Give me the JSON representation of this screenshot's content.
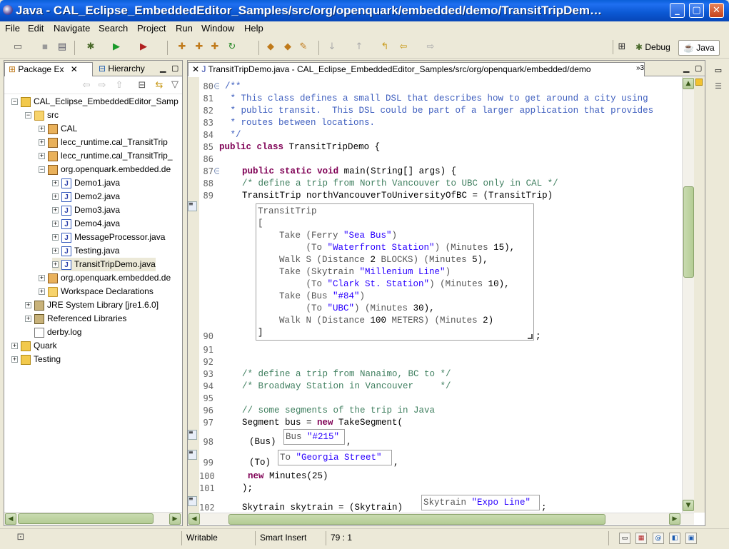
{
  "window": {
    "title": "Java - CAL_Eclipse_EmbeddedEditor_Samples/src/org/openquark/embedded/demo/TransitTripDem…",
    "min": "_",
    "max": "▢",
    "close": "✕"
  },
  "menu": [
    "File",
    "Edit",
    "Navigate",
    "Search",
    "Project",
    "Run",
    "Window",
    "Help"
  ],
  "perspectives": {
    "debug": "Debug",
    "java": "Java"
  },
  "package_explorer": {
    "tabs": [
      {
        "label": "Package Ex"
      },
      {
        "label": "Hierarchy"
      }
    ],
    "tree": [
      {
        "label": "CAL_Eclipse_EmbeddedEditor_Samp",
        "icon": "project-icon",
        "twisty": "−"
      },
      {
        "label": "src",
        "icon": "source-folder-icon",
        "twisty": "−"
      },
      {
        "label": "CAL",
        "icon": "package-icon",
        "twisty": "+"
      },
      {
        "label": "lecc_runtime.cal_TransitTrip",
        "icon": "package-icon",
        "twisty": "+"
      },
      {
        "label": "lecc_runtime.cal_TransitTrip_",
        "icon": "package-icon",
        "twisty": "+"
      },
      {
        "label": "org.openquark.embedded.de",
        "icon": "package-icon",
        "twisty": "−"
      },
      {
        "label": "Demo1.java",
        "icon": "java-file-icon",
        "twisty": "+"
      },
      {
        "label": "Demo2.java",
        "icon": "java-file-icon",
        "twisty": "+"
      },
      {
        "label": "Demo3.java",
        "icon": "java-file-icon",
        "twisty": "+"
      },
      {
        "label": "Demo4.java",
        "icon": "java-file-icon",
        "twisty": "+"
      },
      {
        "label": "MessageProcessor.java",
        "icon": "java-file-icon",
        "twisty": "+"
      },
      {
        "label": "Testing.java",
        "icon": "java-file-icon",
        "twisty": "+"
      },
      {
        "label": "TransitTripDemo.java",
        "icon": "java-file-icon",
        "twisty": "+"
      },
      {
        "label": "org.openquark.embedded.de",
        "icon": "package-icon",
        "twisty": "+"
      },
      {
        "label": "Workspace Declarations",
        "icon": "folder-icon",
        "twisty": "+"
      },
      {
        "label": "JRE System Library [jre1.6.0]",
        "icon": "library-icon",
        "twisty": "+"
      },
      {
        "label": "Referenced Libraries",
        "icon": "library-icon",
        "twisty": "+"
      },
      {
        "label": "derby.log",
        "icon": "file-icon",
        "twisty": ""
      },
      {
        "label": "Quark",
        "icon": "project-icon",
        "twisty": "+"
      },
      {
        "label": "Testing",
        "icon": "project-icon",
        "twisty": "+"
      }
    ]
  },
  "editor": {
    "tab_label": "TransitTripDemo.java - CAL_Eclipse_EmbeddedEditor_Samples/src/org/openquark/embedded/demo",
    "overflow_count": "»3",
    "line_numbers": [
      "80",
      "81",
      "82",
      "83",
      "84",
      "85",
      "86",
      "87",
      "88",
      "89",
      "90",
      "91",
      "92",
      "93",
      "94",
      "95",
      "96",
      "97",
      "98",
      "99",
      "100",
      "101",
      "102"
    ],
    "line_80": "/**",
    "line_81": " * This class defines a small DSL that describes how to get around a city using",
    "line_82": " * public transit.  This DSL could be part of a larger application that provides",
    "line_83": " * routes between locations.",
    "line_84": " */",
    "kw_public": "public",
    "kw_class": "class",
    "kw_static": "static",
    "kw_void": "void",
    "kw_new": "new",
    "class_decl": " TransitTripDemo {",
    "main_sig": " main(String[] args) {",
    "comment_88": "/* define a trip from North Vancouver to UBC only in CAL */",
    "line_89": "TransitTrip northVancouverToUniversityOfBC = (TransitTrip)",
    "line_90_tail": ";",
    "embedded_trip": {
      "header": "TransitTrip",
      "open": "[",
      "close": "]",
      "t1a": "    Take (Ferry ",
      "t1s": "\"Sea Bus\"",
      "t1b": ")",
      "t2a": "         (To ",
      "t2s": "\"Waterfront Station\"",
      "t2b": ") (Minutes ",
      "t2n": "15",
      "t2c": "),",
      "t3a": "    Walk S (Distance ",
      "t3n": "2",
      "t3b": " BLOCKS) (Minutes ",
      "t3m": "5",
      "t3c": "),",
      "t4a": "    Take (Skytrain ",
      "t4s": "\"Millenium Line\"",
      "t4b": ")",
      "t5a": "         (To ",
      "t5s": "\"Clark St. Station\"",
      "t5b": ") (Minutes ",
      "t5n": "10",
      "t5c": "),",
      "t6a": "    Take (Bus ",
      "t6s": "\"#84\"",
      "t6b": ")",
      "t7a": "         (To ",
      "t7s": "\"UBC\"",
      "t7b": ") (Minutes ",
      "t7n": "30",
      "t7c": "),",
      "t8a": "    Walk N (Distance ",
      "t8n": "100",
      "t8b": " METERS) (Minutes ",
      "t8m": "2",
      "t8c": ")"
    },
    "comment_93": "/* define a trip from Nanaimo, BC to */",
    "comment_94": "/* Broadway Station in Vancouver     */",
    "comment_96": "// some segments of the trip in Java",
    "line_97a": "Segment bus = ",
    "line_97b": " TakeSegment(",
    "line_98a": "(Bus)",
    "emb98a": "Bus ",
    "emb98s": "\"#215\"",
    "line_98b": ",",
    "line_99a": "(To)",
    "emb99a": "To ",
    "emb99s": "\"Georgia Street\"",
    "line_99b": ",",
    "line_100b": " Minutes(25)",
    "line_101": ");",
    "line_102a": "Skytrain skytrain = (Skytrain)",
    "emb102a": "Skytrain ",
    "emb102s": "\"Expo Line\"",
    "line_102b": ";"
  },
  "status": {
    "writable": "Writable",
    "insert_mode": "Smart Insert",
    "position": "79 : 1"
  }
}
